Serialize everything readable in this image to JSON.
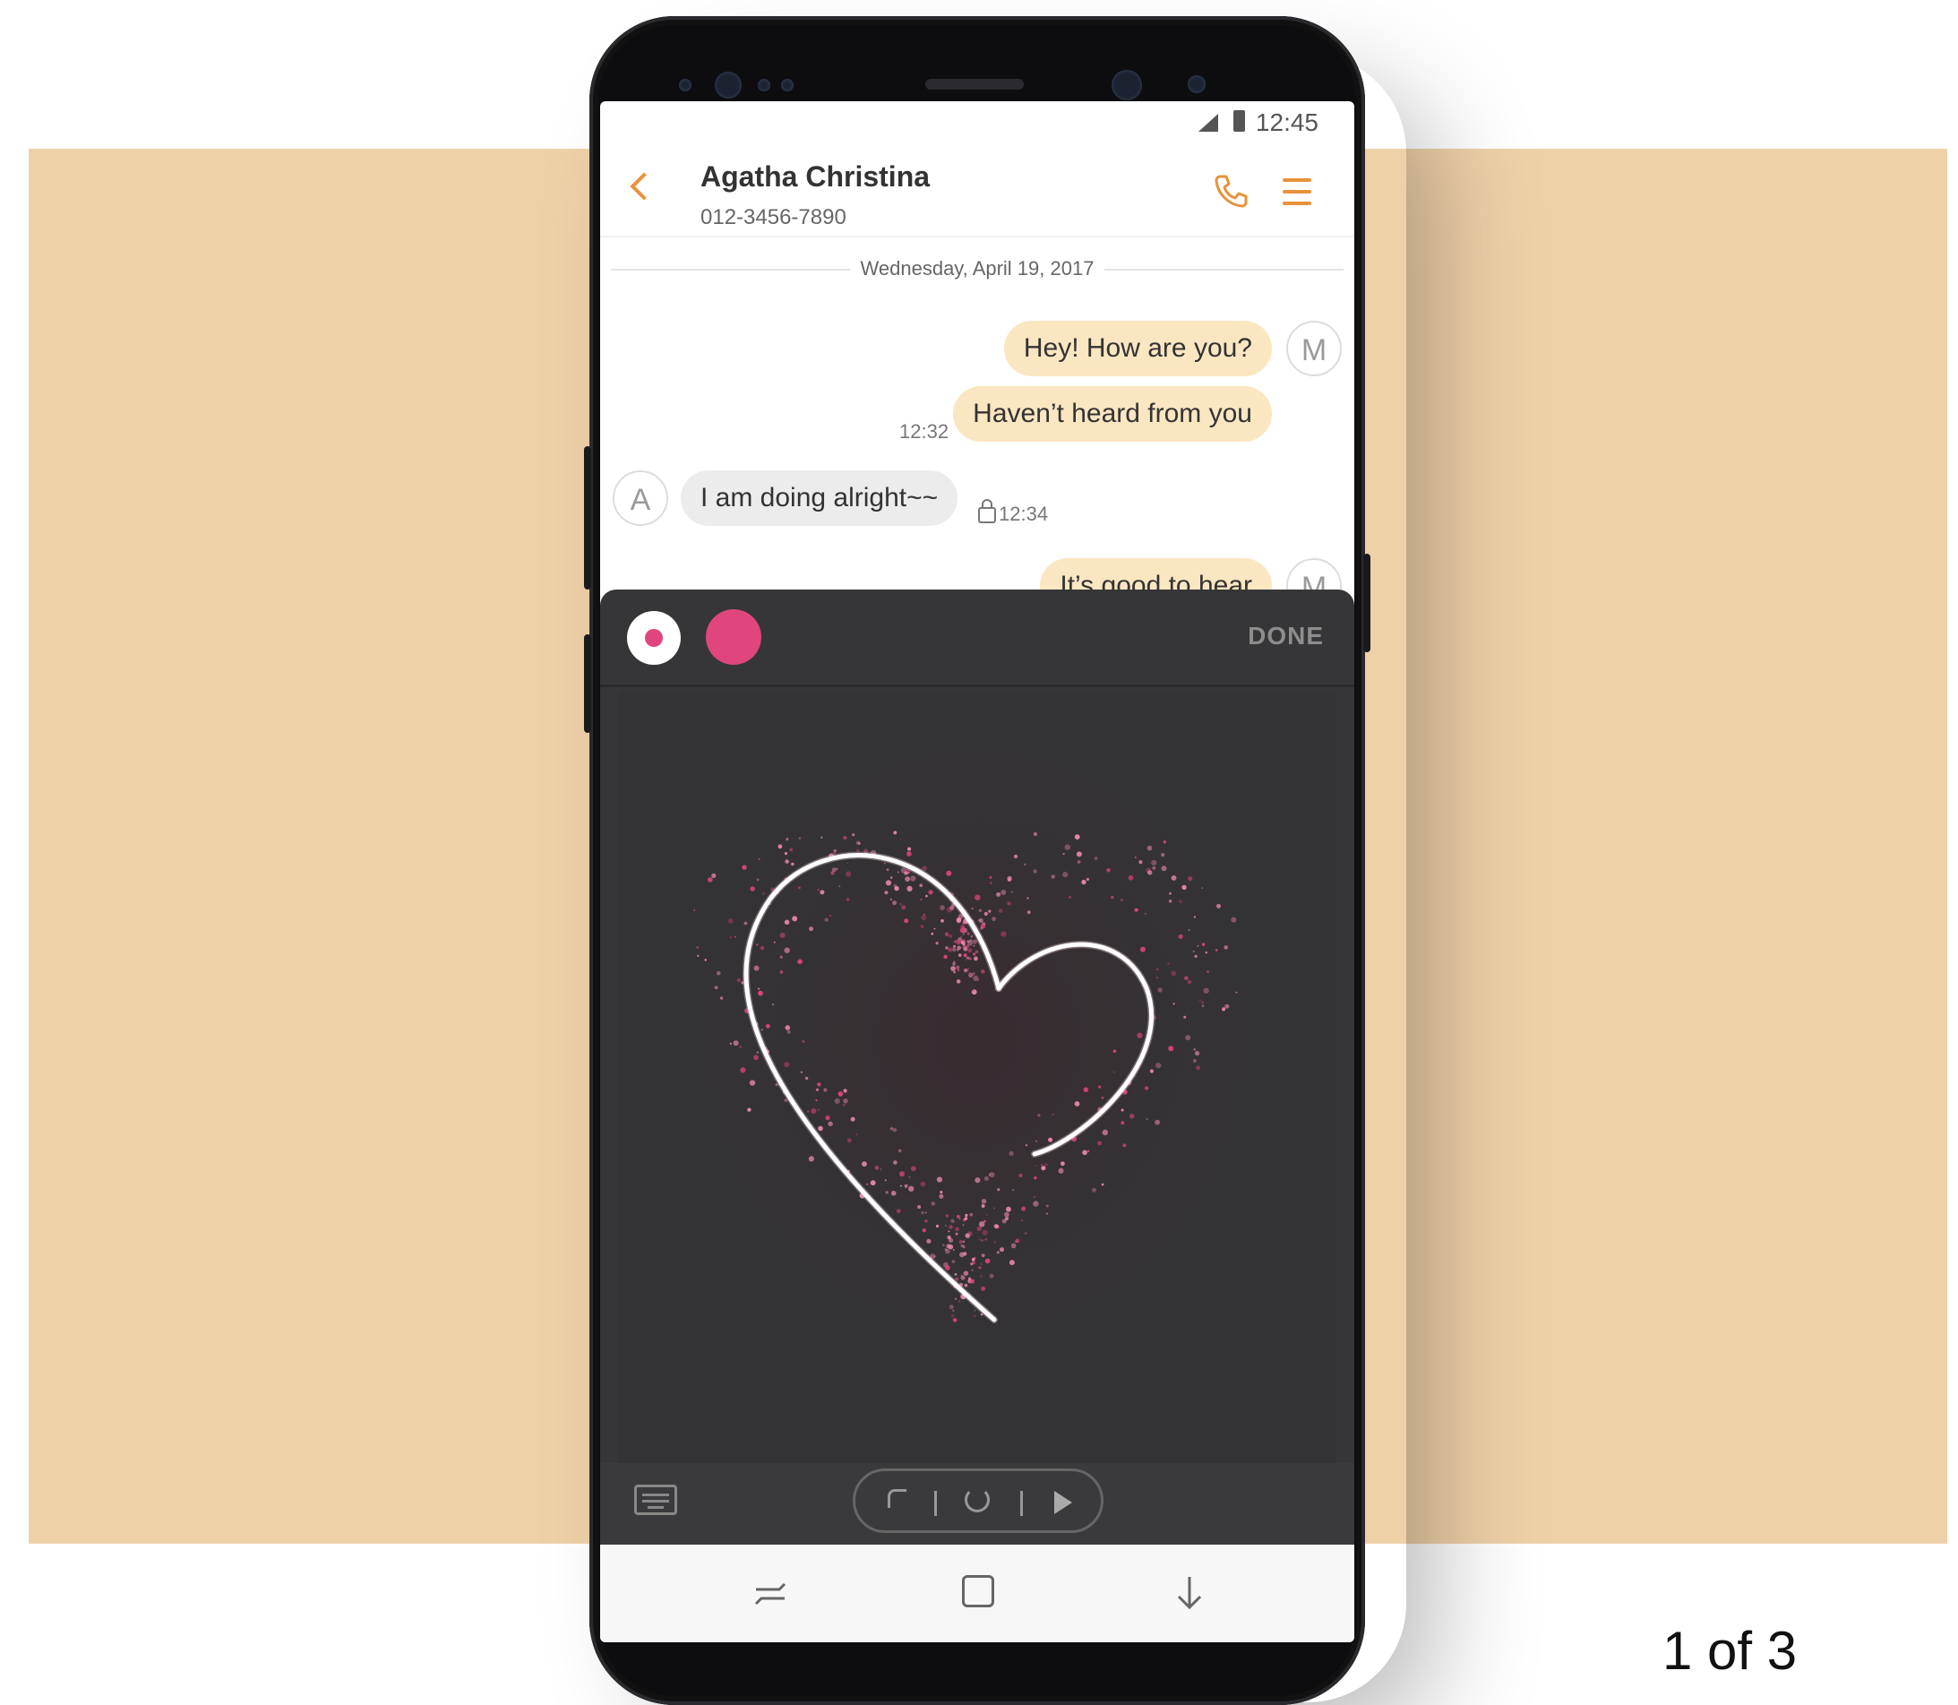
{
  "status_bar": {
    "time": "12:45"
  },
  "conversation": {
    "contact_name": "Agatha Christina",
    "contact_number": "012-3456-7890",
    "date": "Wednesday, April 19, 2017",
    "messages": [
      {
        "direction": "out",
        "text": "Hey! How are you?",
        "avatar": "M",
        "time": ""
      },
      {
        "direction": "out",
        "text": "Haven’t heard from you",
        "avatar": "",
        "time": "12:32"
      },
      {
        "direction": "in",
        "text": "I am doing alright~~",
        "avatar": "A",
        "time": "12:34"
      },
      {
        "direction": "out",
        "text": "It’s good to hear",
        "avatar": "M",
        "time": ""
      }
    ]
  },
  "live_message_panel": {
    "done_label": "DONE",
    "pen_color": "#e0457e",
    "drawing": "heart-sketch"
  },
  "carousel": {
    "counter": "1 of 3"
  },
  "colors": {
    "accent": "#e8923a",
    "backdrop": "#efd1a8",
    "outgoing_bubble": "#fbe6c2"
  }
}
